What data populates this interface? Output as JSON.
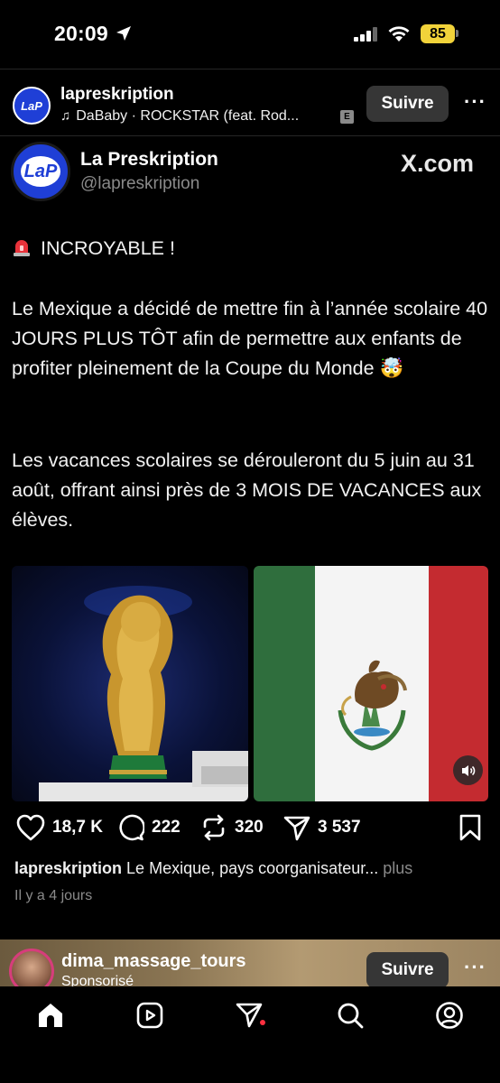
{
  "status_bar": {
    "time": "20:09",
    "battery": "85"
  },
  "post_header": {
    "username": "lapreskription",
    "music": "DaBaby · ROCKSTAR (feat. Rod...",
    "explicit_badge": "E",
    "follow_label": "Suivre",
    "avatar_text": "LaP"
  },
  "tweet": {
    "name": "La Preskription",
    "handle": "@lapreskription",
    "source": "X.com",
    "avatar_text": "LaP",
    "line1": "INCROYABLE !",
    "para1": "Le Mexique a décidé de mettre fin à l’année scolaire 40 JOURS PLUS TÔT afin de permettre aux enfants de profiter pleinement de la Coupe du Monde 🤯",
    "para2": "Les vacances scolaires se dérouleront du 5 juin au 31 août, offrant ainsi près de 3 MOIS DE VACANCES aux élèves."
  },
  "actions": {
    "likes": "18,7 K",
    "comments": "222",
    "reposts": "320",
    "shares": "3 537"
  },
  "caption": {
    "username": "lapreskription",
    "text": "Le Mexique, pays coorganisateur...",
    "more": "plus",
    "time_ago": "Il y a 4 jours"
  },
  "next_post": {
    "username": "dima_massage_tours",
    "sponsored": "Sponsorisé",
    "follow_label": "Suivre"
  },
  "colors": {
    "background": "#000000",
    "follow_button": "#363636",
    "battery": "#f2d33a",
    "notification_dot": "#ff3040",
    "flag_green": "#2f6e3d",
    "flag_red": "#c42b30"
  },
  "icons": {
    "status": [
      "location-arrow-icon",
      "signal-icon",
      "wifi-icon"
    ],
    "actions": [
      "heart-icon",
      "comment-icon",
      "repost-icon",
      "share-icon",
      "bookmark-icon"
    ],
    "nav": [
      "home-icon",
      "reels-icon",
      "send-icon",
      "search-icon",
      "profile-icon"
    ]
  }
}
